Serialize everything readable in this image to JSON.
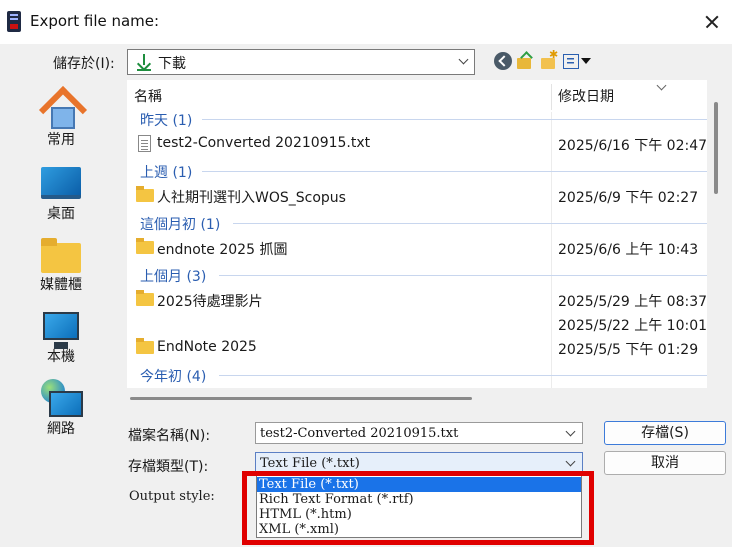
{
  "window": {
    "title": "Export file name:"
  },
  "save_in": {
    "label": "儲存於(I):",
    "value": "下載"
  },
  "places": [
    {
      "label": "常用",
      "icon": "home-icon"
    },
    {
      "label": "桌面",
      "icon": "desktop-icon"
    },
    {
      "label": "媒體櫃",
      "icon": "library-folder-icon"
    },
    {
      "label": "本機",
      "icon": "computer-icon"
    },
    {
      "label": "網路",
      "icon": "network-icon"
    }
  ],
  "columns": {
    "name": "名稱",
    "date": "修改日期"
  },
  "groups": [
    {
      "label": "昨天 (1)"
    },
    {
      "label": "上週 (1)"
    },
    {
      "label": "這個月初 (1)"
    },
    {
      "label": "上個月 (3)"
    },
    {
      "label": "今年初 (4)"
    }
  ],
  "rows": [
    {
      "name": "test2-Converted 20210915.txt",
      "date": "2025/6/16 下午 02:47",
      "icon": "text-file-icon"
    },
    {
      "name": "人社期刊選刊入WOS_Scopus",
      "date": "2025/6/9 下午 02:27",
      "icon": "folder-icon"
    },
    {
      "name": "endnote 2025 抓圖",
      "date": "2025/6/6 上午 10:43",
      "icon": "folder-icon"
    },
    {
      "name": "2025待處理影片",
      "date": "2025/5/29 上午 08:37",
      "icon": "folder-icon"
    },
    {
      "name": "",
      "date": "2025/5/22 上午 10:01",
      "icon": ""
    },
    {
      "name": "EndNote 2025",
      "date": "2025/5/5 下午 01:29",
      "icon": "folder-icon"
    }
  ],
  "file_name": {
    "label": "檔案名稱(N):",
    "value": "test2-Converted 20210915.txt"
  },
  "file_type": {
    "label": "存檔類型(T):",
    "value": "Text File (*.txt)"
  },
  "buttons": {
    "save": "存檔(S)",
    "cancel": "取消"
  },
  "output_style": {
    "label": "Output style:"
  },
  "type_options": [
    {
      "label": "Text File (*.txt)",
      "selected": true
    },
    {
      "label": "Rich Text Format (*.rtf)",
      "selected": false
    },
    {
      "label": "HTML (*.htm)",
      "selected": false
    },
    {
      "label": "XML (*.xml)",
      "selected": false
    }
  ],
  "colors": {
    "selection": "#1a73e8",
    "highlight_box": "#e00000",
    "group_text": "#2a5db0"
  }
}
